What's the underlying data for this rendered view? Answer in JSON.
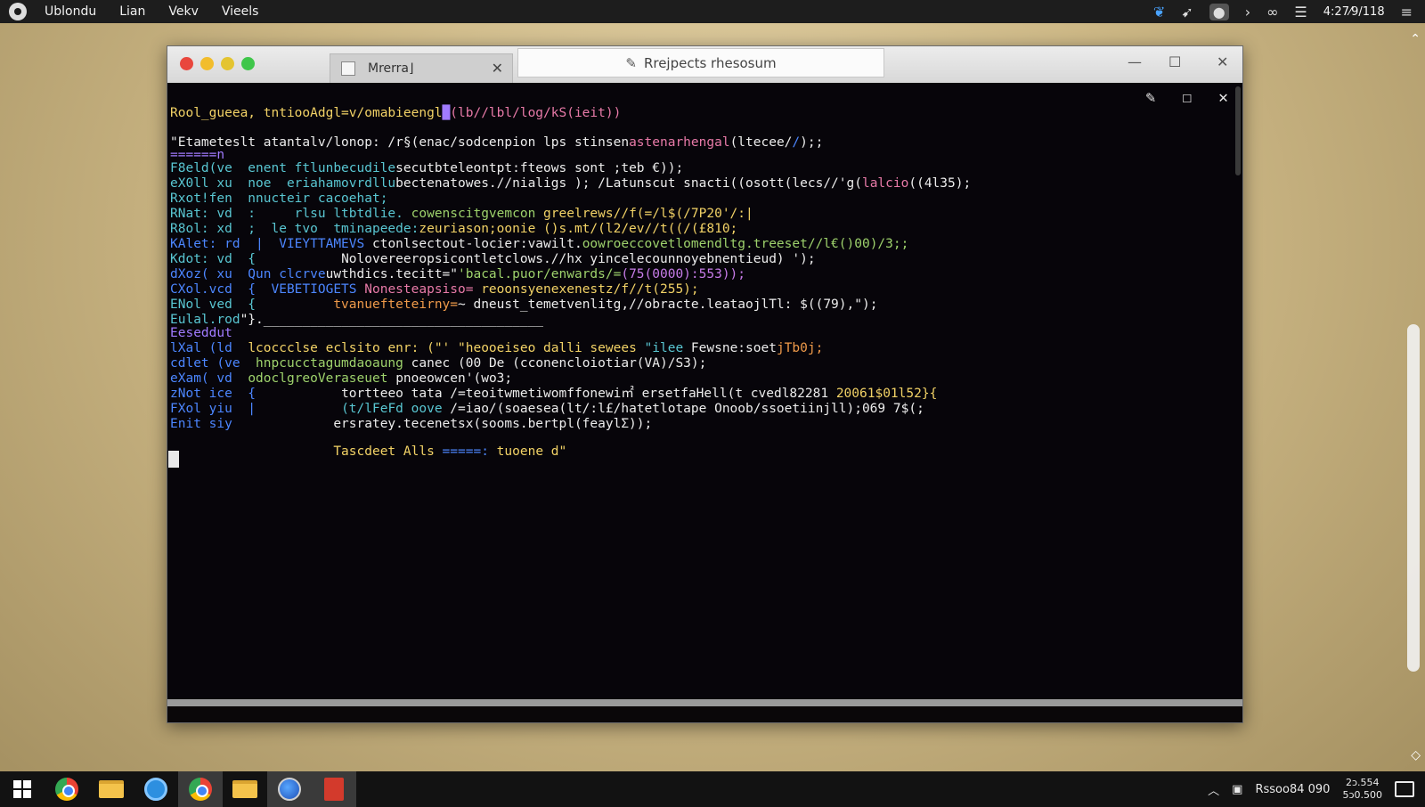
{
  "top_bar": {
    "menus": [
      "Ublondu",
      "Lian",
      "Vekv",
      "Vieels"
    ],
    "clock": "4:27⁄9/118",
    "tray_icons": [
      "bird-icon",
      "signal-icon",
      "user-icon",
      "chevron-icon",
      "link-icon",
      "network-icon",
      "menu-icon"
    ]
  },
  "window": {
    "tabs": [
      {
        "label": "Mrerra⌋"
      },
      {
        "label": "Rrejpects rhesosum"
      }
    ],
    "controls": {
      "minimize": "—",
      "maximize": "☐",
      "close": "✕"
    }
  },
  "terminal": {
    "toolbar": {
      "edit": "✎",
      "maximize": "☐",
      "close": "✕"
    },
    "lines": [
      [
        [
          "Rool_gueea, tntiooAdgl=v/omabieengl",
          "yel"
        ],
        [
          "█",
          "pur"
        ],
        [
          "(lb//lbl/log/kS(ieit))",
          "pnk"
        ]
      ],
      [
        [
          "\"Etameteslt atantalv/lonop: /r§(enac/sodcenpion lps stinsen",
          "wht"
        ],
        [
          "astenarhengal",
          "pnk"
        ],
        [
          "(ltecee/",
          "wht"
        ],
        [
          "/",
          "blu"
        ],
        [
          ");;",
          "wht"
        ]
      ],
      [
        [
          "======n",
          "pur"
        ]
      ],
      [
        [
          "F8eld(ve  enent ftlunbecudile",
          "cya"
        ],
        [
          "secutbteleontpt:fteows sont ;teb €));",
          "wht"
        ]
      ],
      [
        [
          "eX0ll xu  noe  eriahamovrdllu",
          "cya"
        ],
        [
          "bectenatowes.//nialigs",
          "wht"
        ],
        [
          " ); /Latunscut snacti((osott(lecs//'g(",
          "wht"
        ],
        [
          "lalcio",
          "pnk"
        ],
        [
          "((4l35);",
          "wht"
        ]
      ],
      [
        [
          "Rxot!fen  nnucteir cacoehat;",
          "cya"
        ]
      ],
      [
        [
          "RNat: vd  :     rlsu ltbtdlie. ",
          "cya"
        ],
        [
          "cowenscitgvemcon",
          "grn"
        ],
        [
          " greelrews//f(=/l$(/7P20'/:|",
          "yel"
        ]
      ],
      [
        [
          "R8ol: xd  ;  le tvo  tminapeede:",
          "cya"
        ],
        [
          "zeuriason;oonie ()s.mt/(l2/ev//t((/(£810;",
          "yel"
        ]
      ],
      [
        [
          "KAlet: rd  |  VIEYTTAMEVS ",
          "blu"
        ],
        [
          "ctonlsectout-locier:vawilt.",
          "wht"
        ],
        [
          "oowroeccovetlomendltg.treeset//l€()00)/3;;",
          "grn"
        ]
      ],
      [
        [
          "Kdot: vd  {           ",
          "cya"
        ],
        [
          "Nolovereeropsicontletclows.//hx yincelecounnoyebnentieud) ');",
          "wht"
        ]
      ],
      [
        [
          "dXoz( xu  Qun clcrve",
          "blu"
        ],
        [
          "uwthdics.tecitt=\"",
          "wht"
        ],
        [
          "'bacal.puor/enwards/=",
          "grn"
        ],
        [
          "(75(0000):553));",
          "mag"
        ]
      ],
      [
        [
          "CXol.vcd  {  VEBETIOGETS ",
          "blu"
        ],
        [
          "Nonesteapsiso= ",
          "pnk"
        ],
        [
          "reoonsyenexenestz/f//t(255);",
          "yel"
        ]
      ],
      [
        [
          "ENol ved  {          ",
          "cya"
        ],
        [
          "tvanuefteteirny=",
          "ora"
        ],
        [
          "~ dneust_temetvenlitg,//obracte.leataojlTl: $((79),\");",
          "wht"
        ]
      ],
      [
        [
          "Eulal.rod",
          "cya"
        ],
        [
          "\"}.____________________________________",
          "wht"
        ]
      ],
      [
        [
          "Eeseddut",
          "pur"
        ]
      ],
      [
        [
          "lXal (ld  ",
          "blu"
        ],
        [
          "lcoccclse eclsito enr: (\"' \"heooeiseo dalli sewees ",
          "yel"
        ],
        [
          "\"ilee",
          "cya"
        ],
        [
          " Fewsne:soet",
          "wht"
        ],
        [
          "jTb0j;",
          "ora"
        ]
      ],
      [
        [
          "cdlet (ve  ",
          "blu"
        ],
        [
          "hnpcucctagumdaoaung ",
          "grn"
        ],
        [
          "canec (00 De (cconencloiotiar(VA)/S3);",
          "wht"
        ]
      ],
      [
        [
          "eXam( vd  ",
          "blu"
        ],
        [
          "odoclgreoVeraseuet ",
          "grn"
        ],
        [
          "pnoeowcen'(wo3;",
          "wht"
        ]
      ],
      [
        [
          "zNot ice  {           ",
          "blu"
        ],
        [
          "tortteeo tata /=teoitwmetiwomffonewi㎡ ersetfaHell(t cvedl82281 ",
          "wht"
        ],
        [
          "20061$01l52}{",
          "yel"
        ]
      ],
      [
        [
          "FXol yiu  |           ",
          "blu"
        ],
        [
          "(t/lFeFd oove ",
          "cya"
        ],
        [
          "/=iao/(soaesea(lt/:l£/hatetlotape Onoob/ssoetiinjll);069 7$(;",
          "wht"
        ]
      ],
      [
        [
          "Enit siy             ",
          "blu"
        ],
        [
          "ersratey.tecenetsx(sooms.bertpl(feaylΣ));",
          "wht"
        ]
      ],
      [
        [
          "                     ",
          "wht"
        ],
        [
          "Tascdeet Alls ",
          "yel"
        ],
        [
          "=====:",
          "blu"
        ],
        [
          " tuoene d\"",
          "yel"
        ]
      ]
    ]
  },
  "taskbar": {
    "apps": [
      "windows-start",
      "chrome",
      "file-explorer",
      "edge",
      "chrome-active",
      "files",
      "browser",
      "book"
    ],
    "tray_text": "Rssoo84 090",
    "clock_line1": "2ᴐ.554",
    "clock_line2": "5ᴐ0.500"
  }
}
